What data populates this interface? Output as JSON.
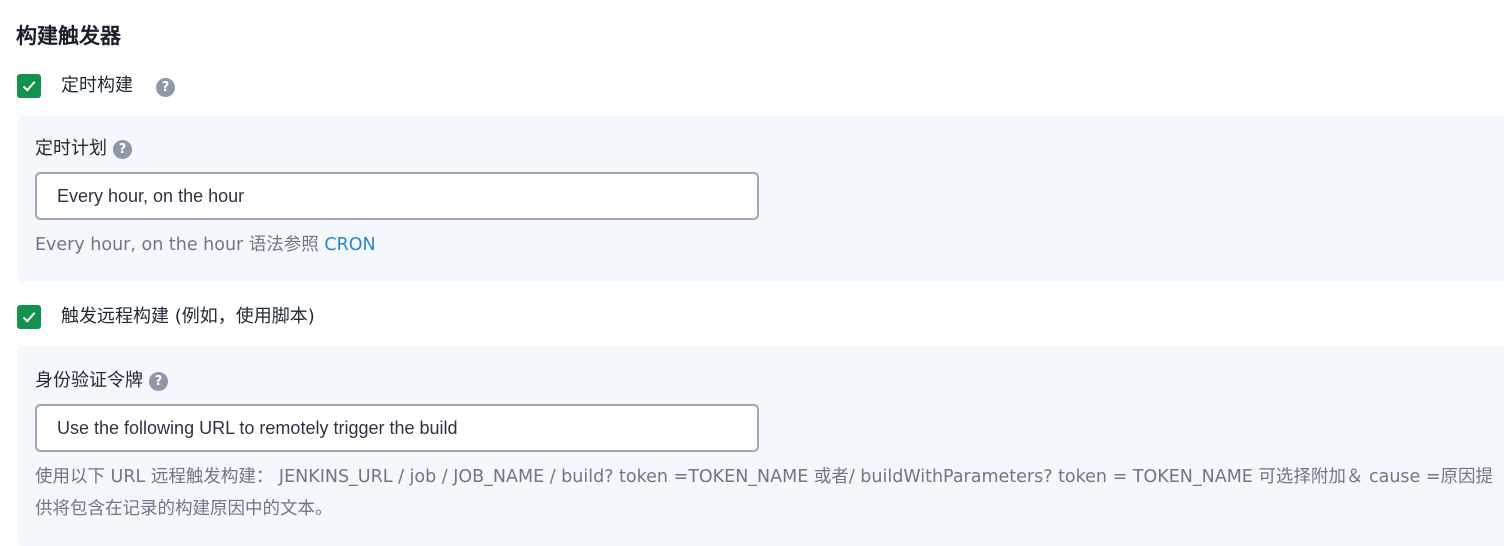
{
  "section": {
    "title": "构建触发器"
  },
  "scheduled_build": {
    "checked": true,
    "label": "定时构建",
    "help_icon": "question-mark-icon",
    "schedule": {
      "label": "定时计划",
      "help_icon": "question-mark-icon",
      "input_value": "Every hour, on the hour",
      "hint_text": "Every hour, on the hour 语法参照 ",
      "hint_link": "CRON"
    }
  },
  "remote_trigger": {
    "checked": true,
    "label": "触发远程构建 (例如，使用脚本)",
    "token": {
      "label": "身份验证令牌",
      "help_icon": "question-mark-icon",
      "input_value": "Use the following URL to remotely trigger the build",
      "hint_text": "使用以下 URL 远程触发构建： JENKINS_URL / job / JOB_NAME / build? token =TOKEN_NAME 或者/ buildWithParameters? token = TOKEN_NAME 可选择附加＆ cause =原因提供将包含在记录的构建原因中的文本。"
    }
  },
  "colors": {
    "checkbox": "#13914f",
    "panel_bg": "#f4f7fb",
    "link": "#2b87c7",
    "help_icon": "#8f98a6"
  }
}
